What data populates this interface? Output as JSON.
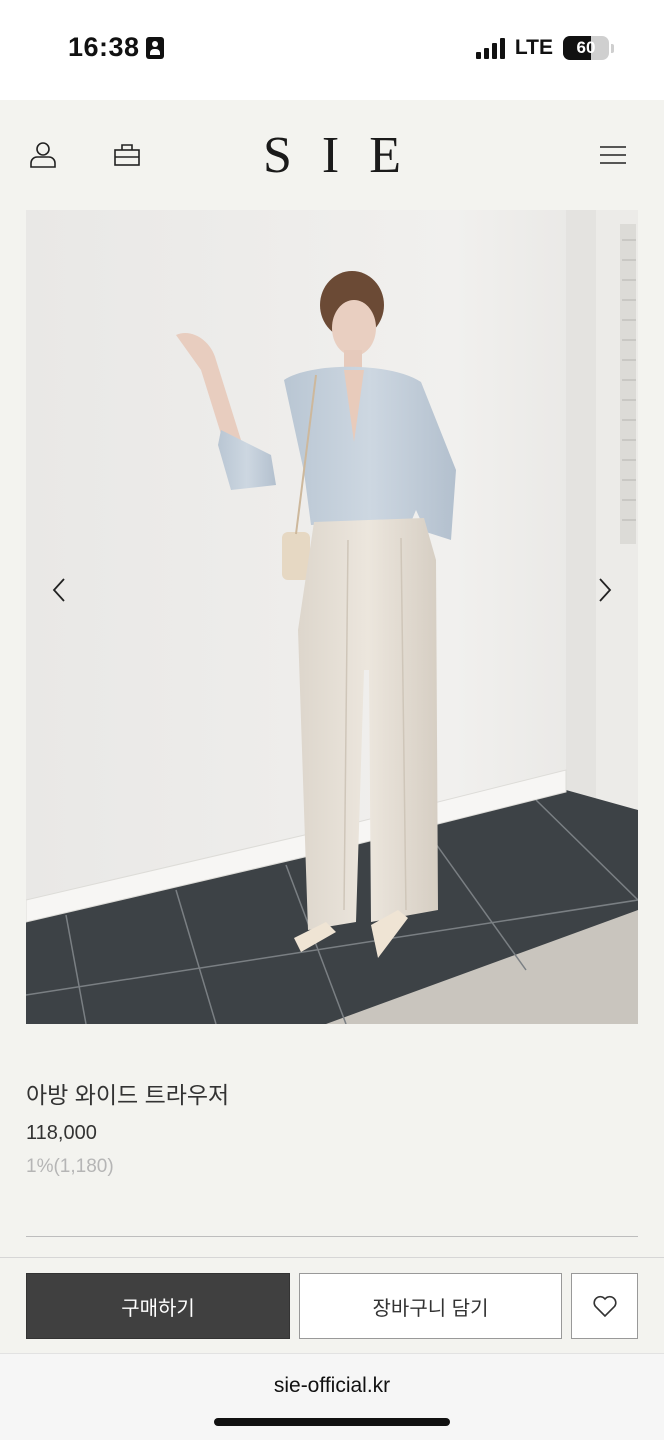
{
  "status_bar": {
    "time": "16:38",
    "network": "LTE",
    "battery": "60",
    "battery_level": 0.6,
    "icons": [
      "contact-card-icon",
      "signal-bars-icon",
      "battery-icon"
    ]
  },
  "header": {
    "logo": "SIE",
    "icons": [
      "user-icon",
      "shopping-bag-icon",
      "hamburger-menu-icon"
    ]
  },
  "gallery": {
    "prev_icon": "chevron-left-icon",
    "next_icon": "chevron-right-icon"
  },
  "product": {
    "name": "아방 와이드 트라우저",
    "price": "118,000",
    "points": "1%(1,180)"
  },
  "actions": {
    "buy_label": "구매하기",
    "cart_label": "장바구니 담기",
    "wishlist_icon": "heart-icon"
  },
  "browser": {
    "url": "sie-official.kr"
  },
  "colors": {
    "background": "#f3f3ef",
    "buy_button": "#404040",
    "point_text": "#b5b5b5"
  }
}
